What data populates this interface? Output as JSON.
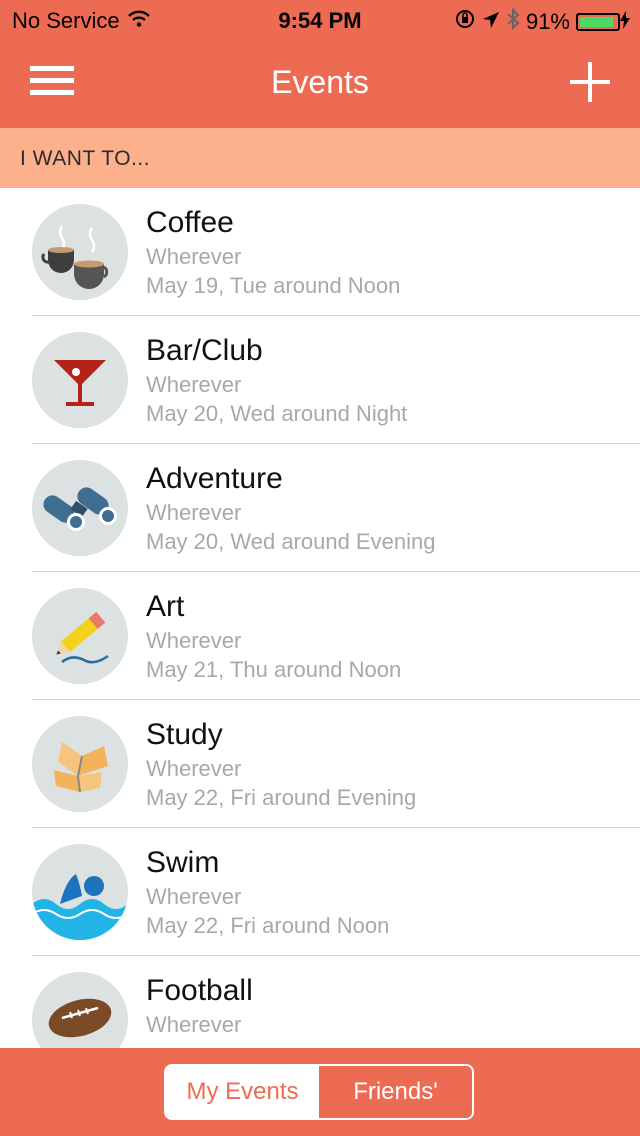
{
  "status_bar": {
    "carrier": "No Service",
    "time": "9:54 PM",
    "battery": "91%",
    "battery_level": 0.91
  },
  "nav": {
    "title": "Events",
    "menu_icon": "hamburger-icon",
    "add_icon": "plus-icon"
  },
  "section": {
    "header": "I WANT TO..."
  },
  "events": [
    {
      "title": "Coffee",
      "location": "Wherever",
      "date": "May 19, Tue around Noon",
      "icon": "coffee-icon"
    },
    {
      "title": "Bar/Club",
      "location": "Wherever",
      "date": "May 20, Wed around Night",
      "icon": "cocktail-icon"
    },
    {
      "title": "Adventure",
      "location": "Wherever",
      "date": "May 20, Wed around Evening",
      "icon": "binoculars-icon"
    },
    {
      "title": "Art",
      "location": "Wherever",
      "date": "May 21, Thu around Noon",
      "icon": "pencil-icon"
    },
    {
      "title": "Study",
      "location": "Wherever",
      "date": "May 22, Fri around Evening",
      "icon": "book-icon"
    },
    {
      "title": "Swim",
      "location": "Wherever",
      "date": "May 22, Fri around Noon",
      "icon": "swimmer-icon"
    },
    {
      "title": "Football",
      "location": "Wherever",
      "date": "",
      "icon": "football-icon"
    }
  ],
  "tabs": {
    "my_events": "My Events",
    "friends": "Friends'"
  },
  "colors": {
    "accent": "#ec6b52",
    "section_bg": "#fcb08c",
    "avatar_bg": "#dbe2e1"
  }
}
